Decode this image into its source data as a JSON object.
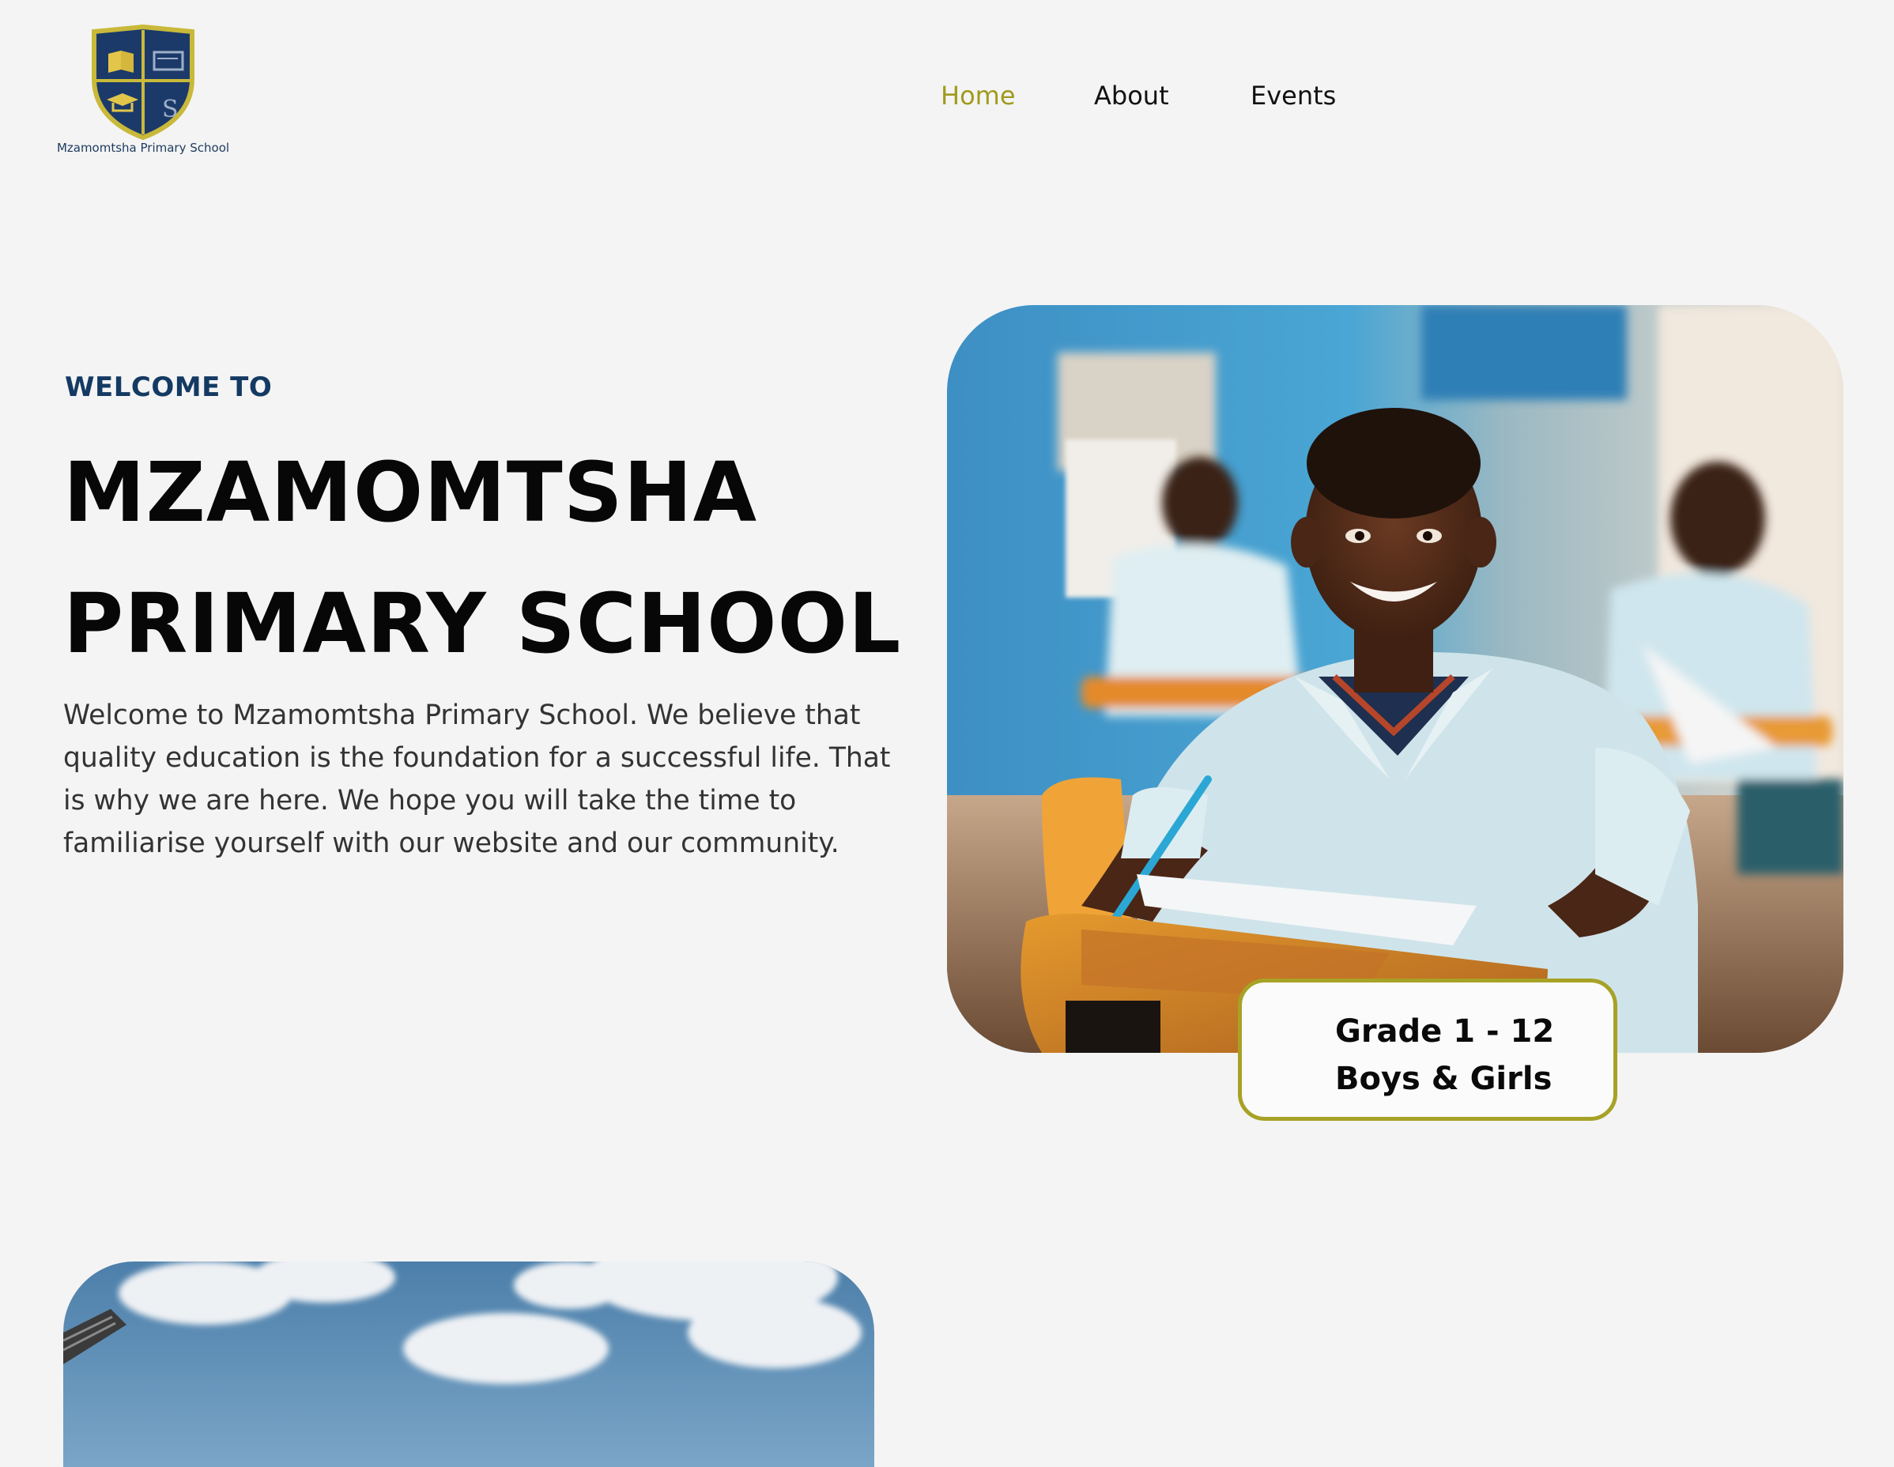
{
  "header": {
    "logo_text": "Mzamomtsha Primary School",
    "nav": [
      {
        "label": "Home",
        "active": true
      },
      {
        "label": "About",
        "active": false
      },
      {
        "label": "Events",
        "active": false
      }
    ]
  },
  "hero": {
    "eyebrow": "WELCOME TO",
    "title_line1": "MZAMOMTSHA",
    "title_line2": "PRIMARY SCHOOL",
    "description": "Welcome to Mzamomtsha Primary School. We believe that quality education is the foundation for a successful life. That is why we are here. We hope you will take the time to familiarise yourself with our website and our community.",
    "badge_line1": "Grade 1 - 12",
    "badge_line2": "Boys & Girls"
  },
  "colors": {
    "background": "#f4f4f4",
    "accent_olive": "#a19a1d",
    "navy": "#143a63",
    "text_dark": "#0a0a0a",
    "text_body": "#333333"
  },
  "icons": {
    "logo": "school-crest-shield",
    "hero_image": "smiling-student-at-desk-photo",
    "second_image": "sky-and-clouds-photo"
  }
}
